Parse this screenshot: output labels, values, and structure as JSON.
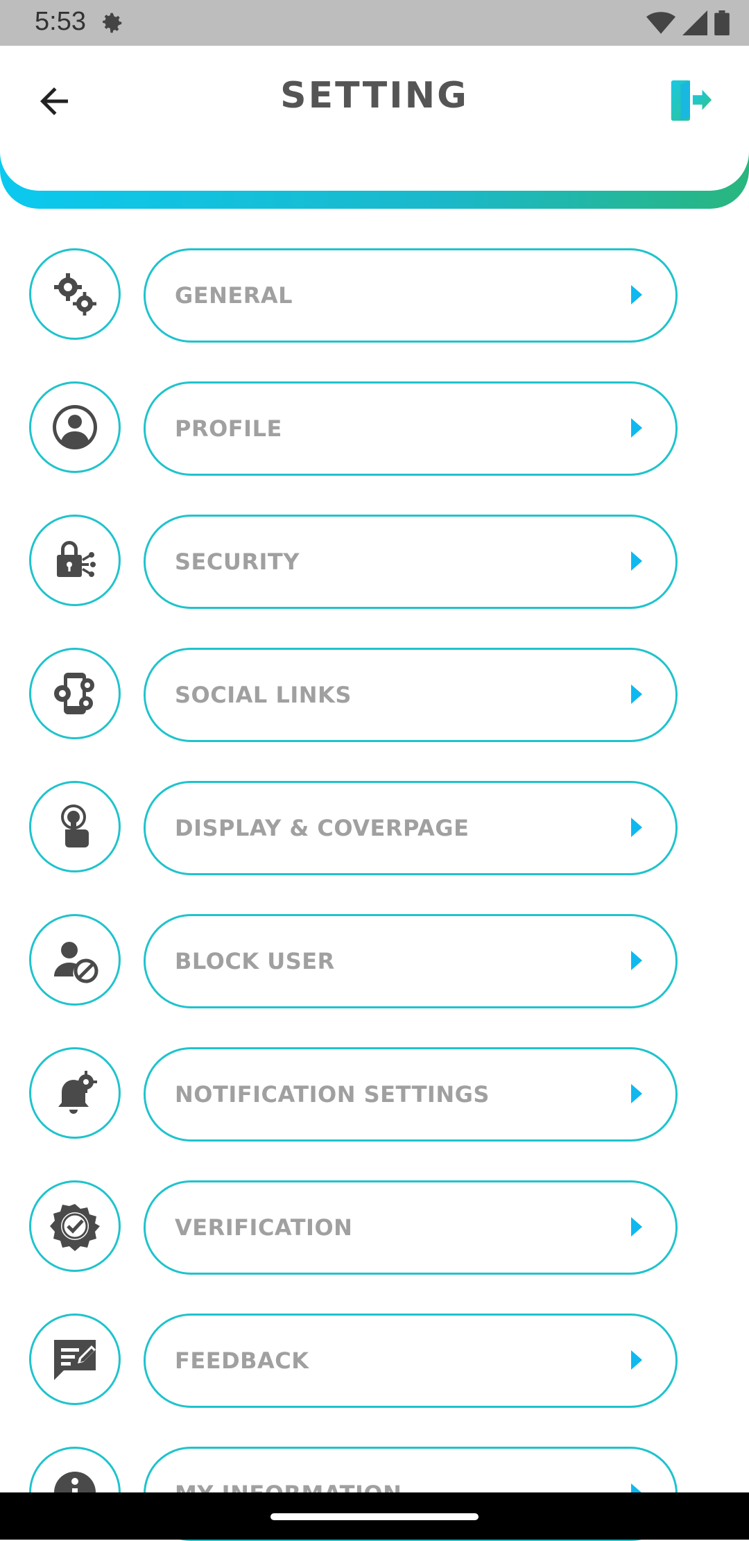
{
  "status": {
    "time": "5:53"
  },
  "header": {
    "title": "SETTING"
  },
  "menu": [
    {
      "label": "GENERAL",
      "icon": "gears-icon"
    },
    {
      "label": "PROFILE",
      "icon": "user-circle-icon"
    },
    {
      "label": "SECURITY",
      "icon": "lock-network-icon"
    },
    {
      "label": "SOCIAL LINKS",
      "icon": "social-phone-icon"
    },
    {
      "label": "DISPLAY & COVERPAGE",
      "icon": "touch-display-icon"
    },
    {
      "label": "BLOCK USER",
      "icon": "block-user-icon"
    },
    {
      "label": "NOTIFICATION SETTINGS",
      "icon": "bell-gear-icon"
    },
    {
      "label": "VERIFICATION",
      "icon": "verified-badge-icon"
    },
    {
      "label": "FEEDBACK",
      "icon": "feedback-icon"
    },
    {
      "label": "MY INFORMATION",
      "icon": "info-icon"
    }
  ],
  "colors": {
    "accent": "#1fc3cc",
    "arrow": "#0fb8ef",
    "label": "#a0a0a0",
    "title": "#555555",
    "icon": "#4a4a4a"
  }
}
